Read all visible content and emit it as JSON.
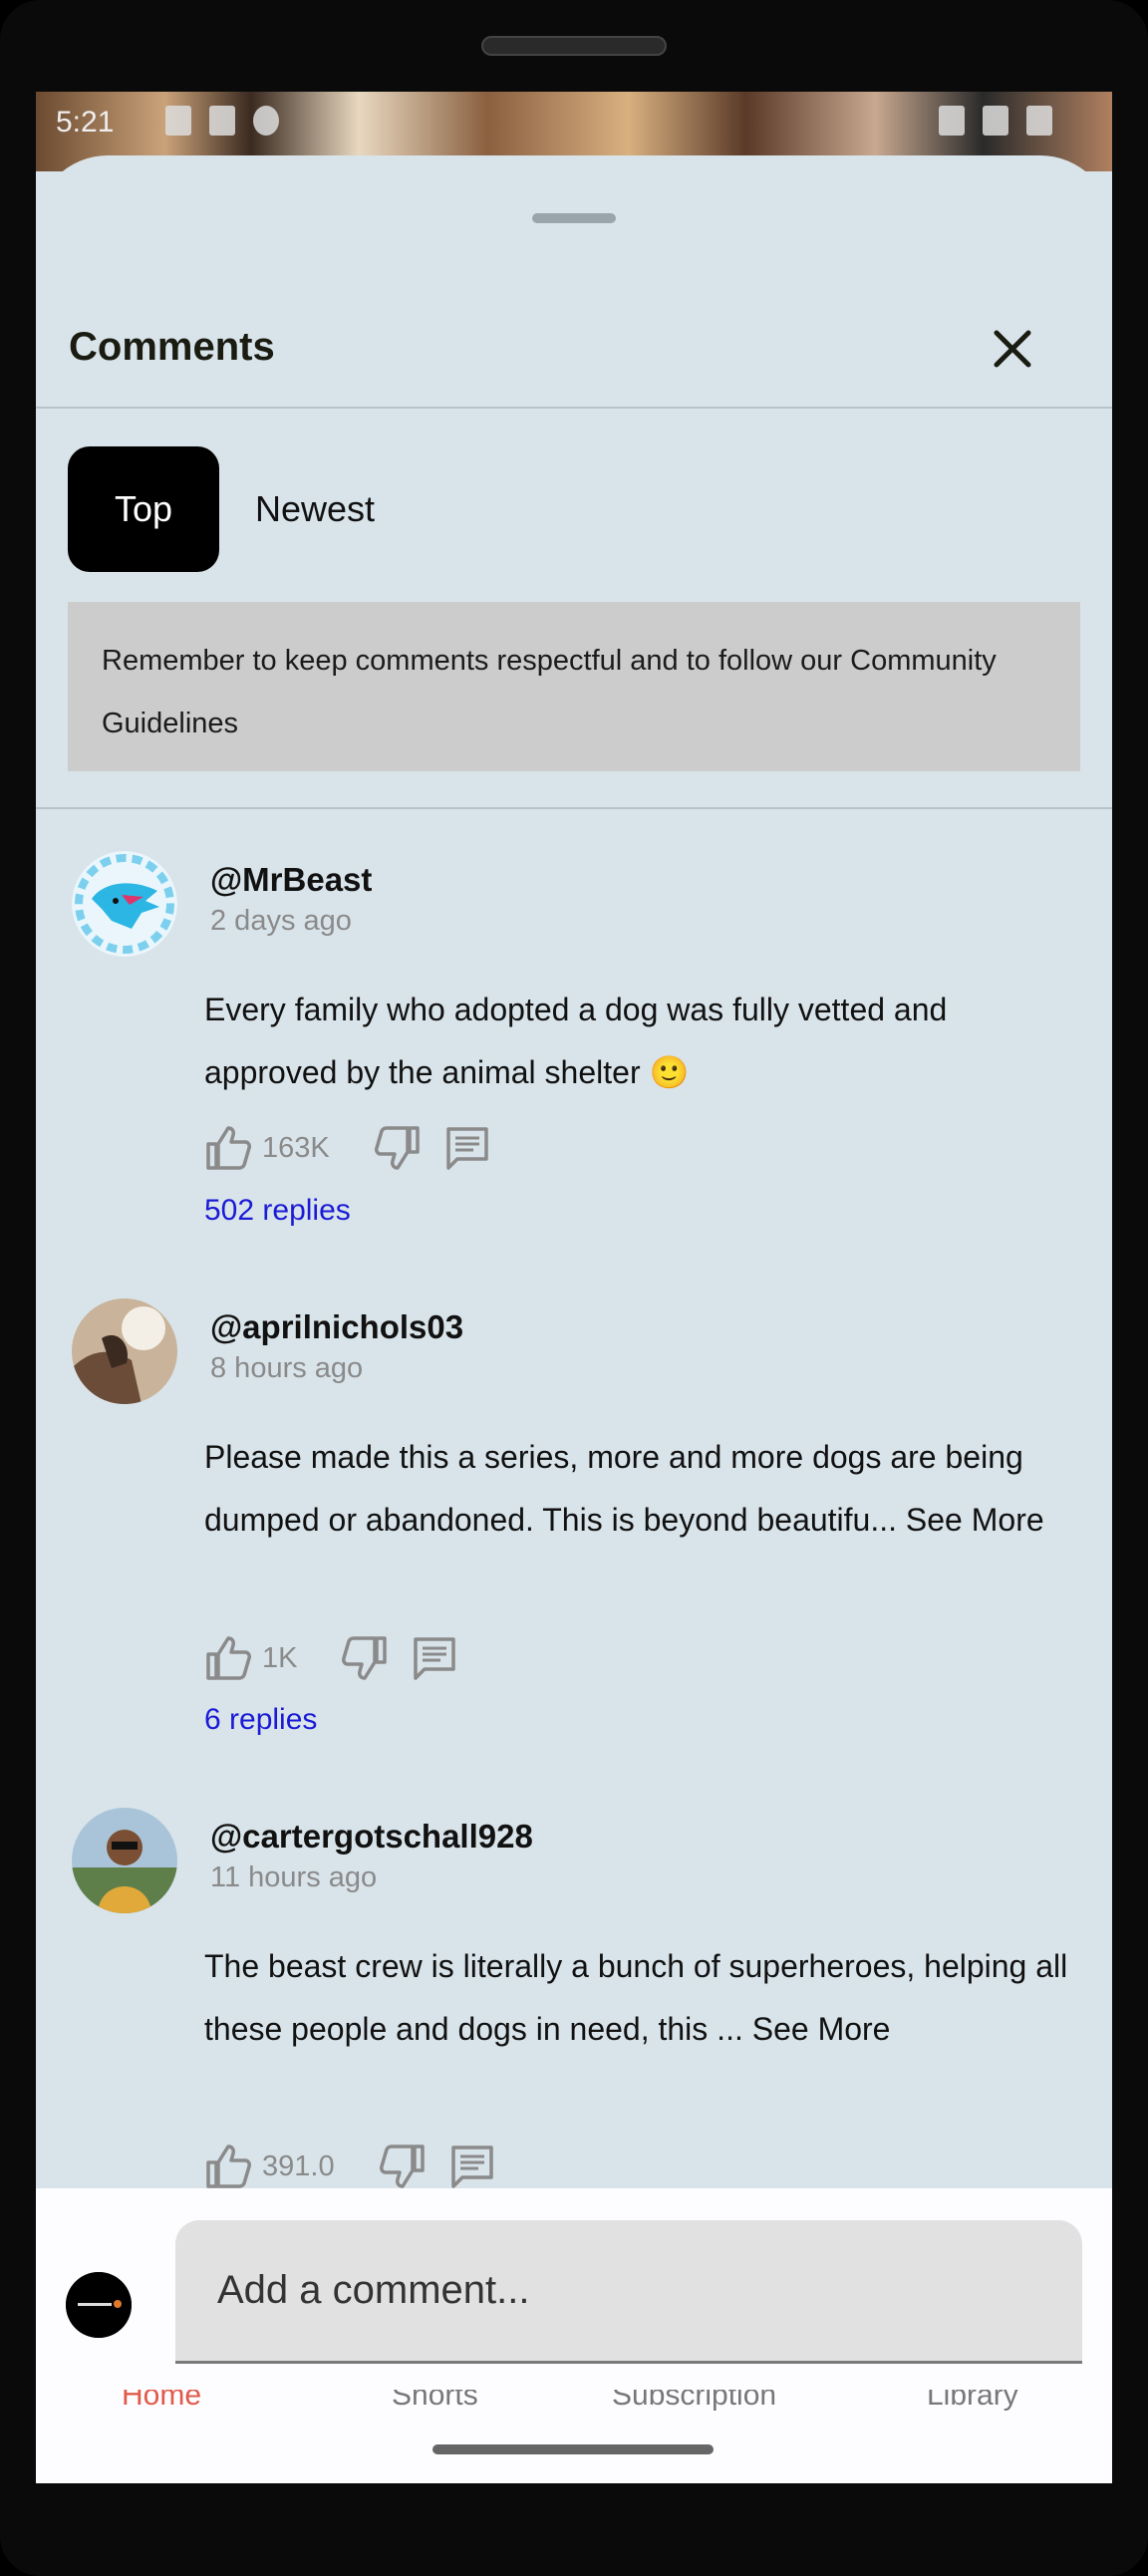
{
  "status": {
    "time": "5:21"
  },
  "sheet": {
    "title": "Comments"
  },
  "sort": {
    "top_label": "Top",
    "newest_label": "Newest"
  },
  "notice": {
    "text": "Remember to keep comments respectful and to follow our Community Guidelines"
  },
  "comments": [
    {
      "author": "@MrBeast",
      "time": "2 days ago",
      "text": "Every family who adopted a dog was fully vetted and approved by the animal shelter 🙂",
      "likes": "163K",
      "replies": "502 replies"
    },
    {
      "author": "@aprilnichols03",
      "time": "8 hours ago",
      "text": "Please made this a series, more and more dogs are being dumped or abandoned. This is beyond beautifu... See More",
      "likes": "1K",
      "replies": "6 replies"
    },
    {
      "author": "@cartergotschall928",
      "time": "11 hours ago",
      "text": "The beast crew is literally a bunch of superheroes, helping all these people and dogs in need, this ... See More",
      "likes": "391.0"
    }
  ],
  "composer": {
    "placeholder": "Add a comment..."
  },
  "bottom_nav": [
    "Home",
    "Shorts",
    "Subscription",
    "Library"
  ],
  "colors": {
    "sheet_bg": "#d9e4ea",
    "reply_link": "#1b1bd6",
    "active_nav": "#e05a4a"
  },
  "icons": [
    "close-icon",
    "thumbs-up-icon",
    "thumbs-down-icon",
    "reply-icon"
  ]
}
